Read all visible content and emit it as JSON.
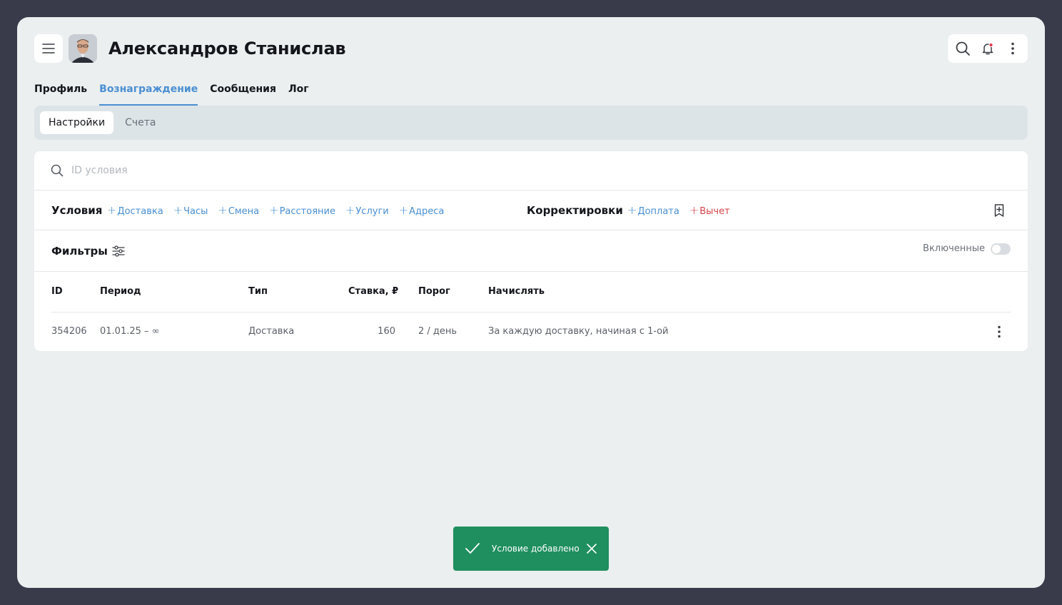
{
  "header": {
    "title": "Александров Станислав"
  },
  "tabs": [
    {
      "label": "Профиль",
      "active": false
    },
    {
      "label": "Вознаграждение",
      "active": true
    },
    {
      "label": "Сообщения",
      "active": false
    },
    {
      "label": "Лог",
      "active": false
    }
  ],
  "subtabs": [
    {
      "label": "Настройки",
      "active": true
    },
    {
      "label": "Счета",
      "active": false
    }
  ],
  "search": {
    "placeholder": "ID условия",
    "value": ""
  },
  "conditions": {
    "title": "Условия",
    "links": [
      "Доставка",
      "Часы",
      "Смена",
      "Расстояние",
      "Услуги",
      "Адреса"
    ]
  },
  "adjustments": {
    "title": "Корректировки",
    "links": [
      {
        "label": "Доплата",
        "color": "#4a8fd2"
      },
      {
        "label": "Вычет",
        "color": "#d2444a"
      }
    ]
  },
  "filters": {
    "title": "Фильтры",
    "toggle_label": "Включенные",
    "toggle_on": false
  },
  "table": {
    "columns": [
      "ID",
      "Период",
      "Тип",
      "Ставка, ₽",
      "Порог",
      "Начислять"
    ],
    "rows": [
      {
        "id": "354206",
        "period": "01.01.25 – ∞",
        "type": "Доставка",
        "rate": "160",
        "threshold": "2 / день",
        "accrue": "За каждую доставку, начиная с 1-ой"
      }
    ]
  },
  "toast": {
    "message": "Условие добавлено",
    "color": "#1f8f5f"
  },
  "colors": {
    "accent": "#4a8fd2",
    "danger": "#d2444a",
    "notification_dot": "#e0364f"
  }
}
